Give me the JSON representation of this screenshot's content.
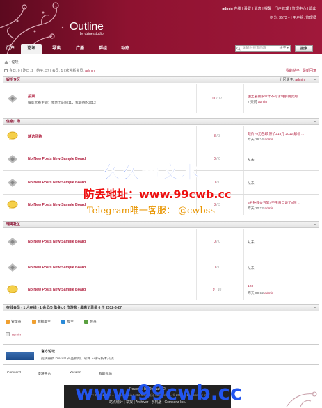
{
  "header": {
    "logo_title": "Outline",
    "logo_sub": "by dzinerstudio",
    "top_links": [
      "admin",
      "在线",
      "设置",
      "消息",
      "提醒",
      "门户管理",
      "管理中心",
      "退出"
    ],
    "credit_text": "积分: 3573",
    "user_group": "用户组: 管理员"
  },
  "nav": {
    "tabs": [
      "门户",
      "论坛",
      "导读",
      "广播",
      "群组",
      "动态"
    ],
    "active": "论坛"
  },
  "search": {
    "placeholder": "请输入搜索内容",
    "type": "帖子",
    "button": "搜索"
  },
  "breadcrumb": "论坛",
  "stats": {
    "today": "今日: 0",
    "yesterday": "昨日: 2",
    "posts": "帖子: 37",
    "members": "会员: 1",
    "welcome_prefix": "欢迎新会员:",
    "new_member": "admin"
  },
  "top_actions": [
    "我的帖子",
    "最新回复"
  ],
  "sections": [
    {
      "title": "娱乐专区",
      "moderator_label": "分区版主:",
      "moderator": "admin",
      "rows": [
        {
          "name": "投票",
          "desc": "摄影大赛主题：我亲历的2011，我期待的2012",
          "threads": "11",
          "posts": "17",
          "last_title": "国土部要求今年不得求特别要卖用 ...",
          "last_time": "7 天前",
          "last_user": "admin",
          "icon": "dim"
        }
      ]
    },
    {
      "title": "信息广场",
      "rows": [
        {
          "name": "精选团购",
          "desc": "",
          "threads": "3",
          "posts": "3",
          "last_title": "既价79元包邮 原价218元 2012 解析 ...",
          "last_time": "昨天 16:34",
          "last_user": "admin",
          "icon": "new"
        },
        {
          "name": "No New Posts New Sample Board",
          "desc": "",
          "threads": "0",
          "posts": "0",
          "never": "从未",
          "icon": "dim"
        },
        {
          "name": "No New Posts New Sample Board",
          "desc": "",
          "threads": "0",
          "posts": "0",
          "never": "从未",
          "icon": "dim"
        },
        {
          "name": "No New Posts New Sample Board",
          "desc": "",
          "threads": "3",
          "posts": "3",
          "last_title": "5分钟教会五笔!!不用背口诀了!(附 ...",
          "last_time": "昨天 10:12",
          "last_user": "admin",
          "icon": "new"
        }
      ]
    },
    {
      "title": "瑞海社区",
      "rows": [
        {
          "name": "No New Posts New Sample Board",
          "desc": "",
          "threads": "0",
          "posts": "0",
          "never": "从未",
          "icon": "dim"
        },
        {
          "name": "No New Posts New Sample Board",
          "desc": "",
          "threads": "0",
          "posts": "0",
          "never": "从未",
          "icon": "dim"
        },
        {
          "name": "No New Posts New Sample Board",
          "desc": "",
          "threads": "9",
          "posts": "10",
          "last_title": "123",
          "last_time": "昨天 09:12",
          "last_user": "admin",
          "icon": "new"
        }
      ]
    }
  ],
  "online": {
    "header": "在线会员 - 1 人在线 - 1 会员(0 隐身), 0 位游客 - 最高记录是 6 于 2012-3-27.",
    "legend": [
      {
        "label": "管理员",
        "color": "#f0a030"
      },
      {
        "label": "超级版主",
        "color": "#f0a030"
      },
      {
        "label": "版主",
        "color": "#2a8ad8"
      },
      {
        "label": "会员",
        "color": "#5aa040"
      }
    ],
    "members": [
      "admin"
    ]
  },
  "official": {
    "title": "官方论坛",
    "desc": "提供最新 Discuz! 产品新闻、软件下载与技术交流"
  },
  "links": [
    "Comsenz",
    "漫游平台",
    "Yeswan",
    "我的领地"
  ],
  "footer": {
    "powered": "Powered by Discuz! X2",
    "processed": "GMT+8, 2012-3-28 ... Processed in 0.082 second(s), 55 queries ... © 2001-2012 Comsenz Inc.",
    "links": "站点统计 | 举报 | Archiver | 手机版 | Comsenz Inc."
  },
  "watermarks": [
    "久久超文本",
    "防丢地址：www.99cwb.cc",
    "Telegram唯一客服： @cwbss",
    "www.99cwb.cc"
  ]
}
